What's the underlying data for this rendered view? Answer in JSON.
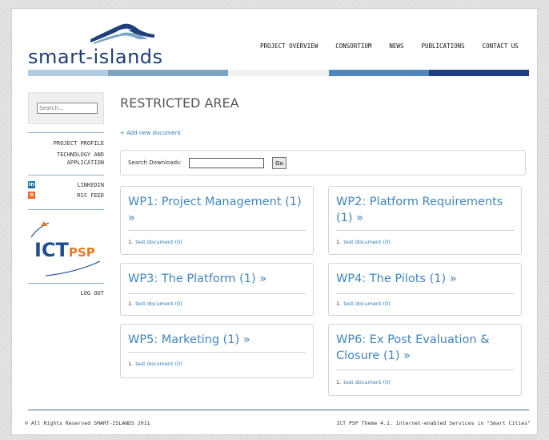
{
  "header": {
    "logo_text": "smart-islands",
    "nav": [
      "PROJECT OVERVIEW",
      "CONSORTIUM",
      "NEWS",
      "PUBLICATIONS",
      "CONTACT US"
    ],
    "colorbar": [
      "#b3cbe0",
      "#7ea4c4",
      "#f0f0f0",
      "#4f86bd",
      "#1e3d84"
    ]
  },
  "sidebar": {
    "search_placeholder": "Search...",
    "links": [
      "PROJECT PROFILE",
      "TECHNOLOGY AND APPLICATION"
    ],
    "social": [
      {
        "label": "LINKEDIN",
        "icon": "linkedin-icon",
        "glyph": "in",
        "color": "#0e76a8"
      },
      {
        "label": "RSS FEED",
        "icon": "rss-icon",
        "glyph": "≋",
        "color": "#f26522"
      }
    ],
    "ict_logo": {
      "main": "ICT",
      "sub": "PSP"
    },
    "logout": "LOG OUT"
  },
  "main": {
    "title": "RESTRICTED AREA",
    "add_link": "+ Add new document",
    "search_label": "Search Downloads:",
    "search_button": "Go",
    "cards": [
      {
        "title": "WP1: Project Management (1) »",
        "num": "1.",
        "doc": "test document (0)"
      },
      {
        "title": "WP2: Platform Requirements (1) »",
        "num": "1.",
        "doc": "test document (0)"
      },
      {
        "title": "WP3: The Platform (1) »",
        "num": "1.",
        "doc": "test document (0)"
      },
      {
        "title": "WP4: The Pilots (1) »",
        "num": "1.",
        "doc": "test document (0)"
      },
      {
        "title": "WP5: Marketing (1) »",
        "num": "1.",
        "doc": "test document (0)"
      },
      {
        "title": "WP6: Ex Post Evaluation & Closure (1) »",
        "num": "1.",
        "doc": "test document (0)"
      }
    ]
  },
  "footer": {
    "copyright": "© All Rights Reserved SMART-ISLANDS  2011",
    "theme": "ICT PSP Theme 4.1. Internet-enabled Services in \"Smart Cities\""
  }
}
